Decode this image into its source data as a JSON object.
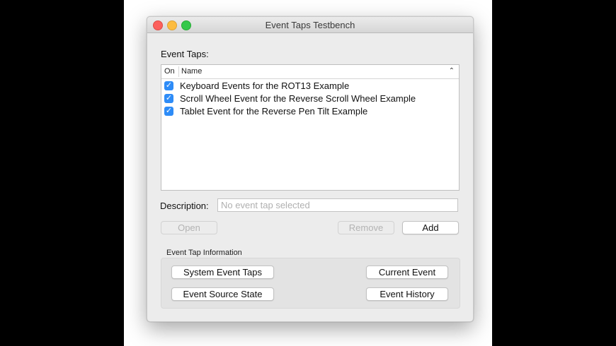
{
  "window": {
    "title": "Event Taps Testbench"
  },
  "event_taps": {
    "label": "Event Taps:",
    "columns": {
      "on": "On",
      "name": "Name"
    },
    "rows": [
      {
        "checked": true,
        "name": "Keyboard Events for the ROT13 Example"
      },
      {
        "checked": true,
        "name": "Scroll Wheel Event for the Reverse Scroll Wheel Example"
      },
      {
        "checked": true,
        "name": "Tablet Event for the Reverse Pen Tilt Example"
      }
    ]
  },
  "description": {
    "label": "Description:",
    "value": "",
    "placeholder": "No event tap selected"
  },
  "buttons": {
    "open": "Open",
    "remove": "Remove",
    "add": "Add"
  },
  "info": {
    "label": "Event Tap Information",
    "system_event_taps": "System Event Taps",
    "current_event": "Current Event",
    "event_source_state": "Event Source State",
    "event_history": "Event History"
  },
  "icons": {
    "checkbox": "checkmark-icon",
    "sort": "chevron-up-icon"
  },
  "colors": {
    "checkbox": "#2e8cf7",
    "close": "#fc605c",
    "minimize": "#fdbc40",
    "maximize": "#34c84a"
  }
}
